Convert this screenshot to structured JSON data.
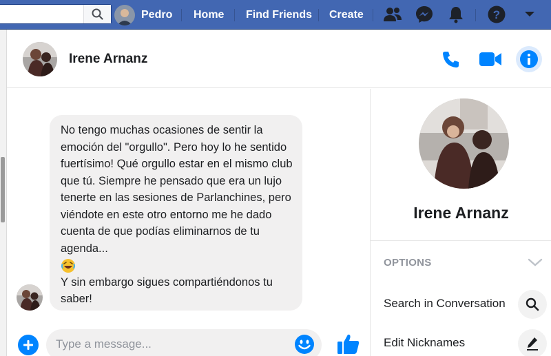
{
  "topbar": {
    "search_placeholder": "",
    "user_name": "Pedro",
    "nav": [
      "Home",
      "Find Friends",
      "Create"
    ],
    "icons": [
      "friends-icon",
      "messenger-icon",
      "notifications-icon",
      "help-icon",
      "account-menu-icon"
    ],
    "bg_color": "#4267b2"
  },
  "conversation": {
    "contact_name": "Irene Arnanz",
    "header_icons": [
      "phone-icon",
      "video-camera-icon",
      "info-icon"
    ],
    "accent_color": "#0084ff"
  },
  "message": {
    "text_part1": "No tengo muchas ocasiones de sentir la emoción del \"orgullo\". Pero hoy lo he sentido fuertísimo! Qué orgullo estar en el mismo club que tú. Siempre he pensado que era un lujo tenerte en las sesiones de Parlanchines, pero viéndote en este otro entorno me he dado cuenta de que podías eliminarnos de tu agenda...",
    "emoji": "rolling-on-the-floor-laughing-emoji",
    "text_part2": "Y sin embargo sigues compartiéndonos tu saber!"
  },
  "composer": {
    "placeholder": "Type a message...",
    "icons": [
      "add-icon",
      "emoji-icon",
      "thumbs-up-icon"
    ]
  },
  "info_panel": {
    "name": "Irene Arnanz",
    "options_title": "OPTIONS",
    "options": [
      {
        "label": "Search in Conversation",
        "icon": "search-icon"
      },
      {
        "label": "Edit Nicknames",
        "icon": "pencil-icon"
      }
    ]
  }
}
